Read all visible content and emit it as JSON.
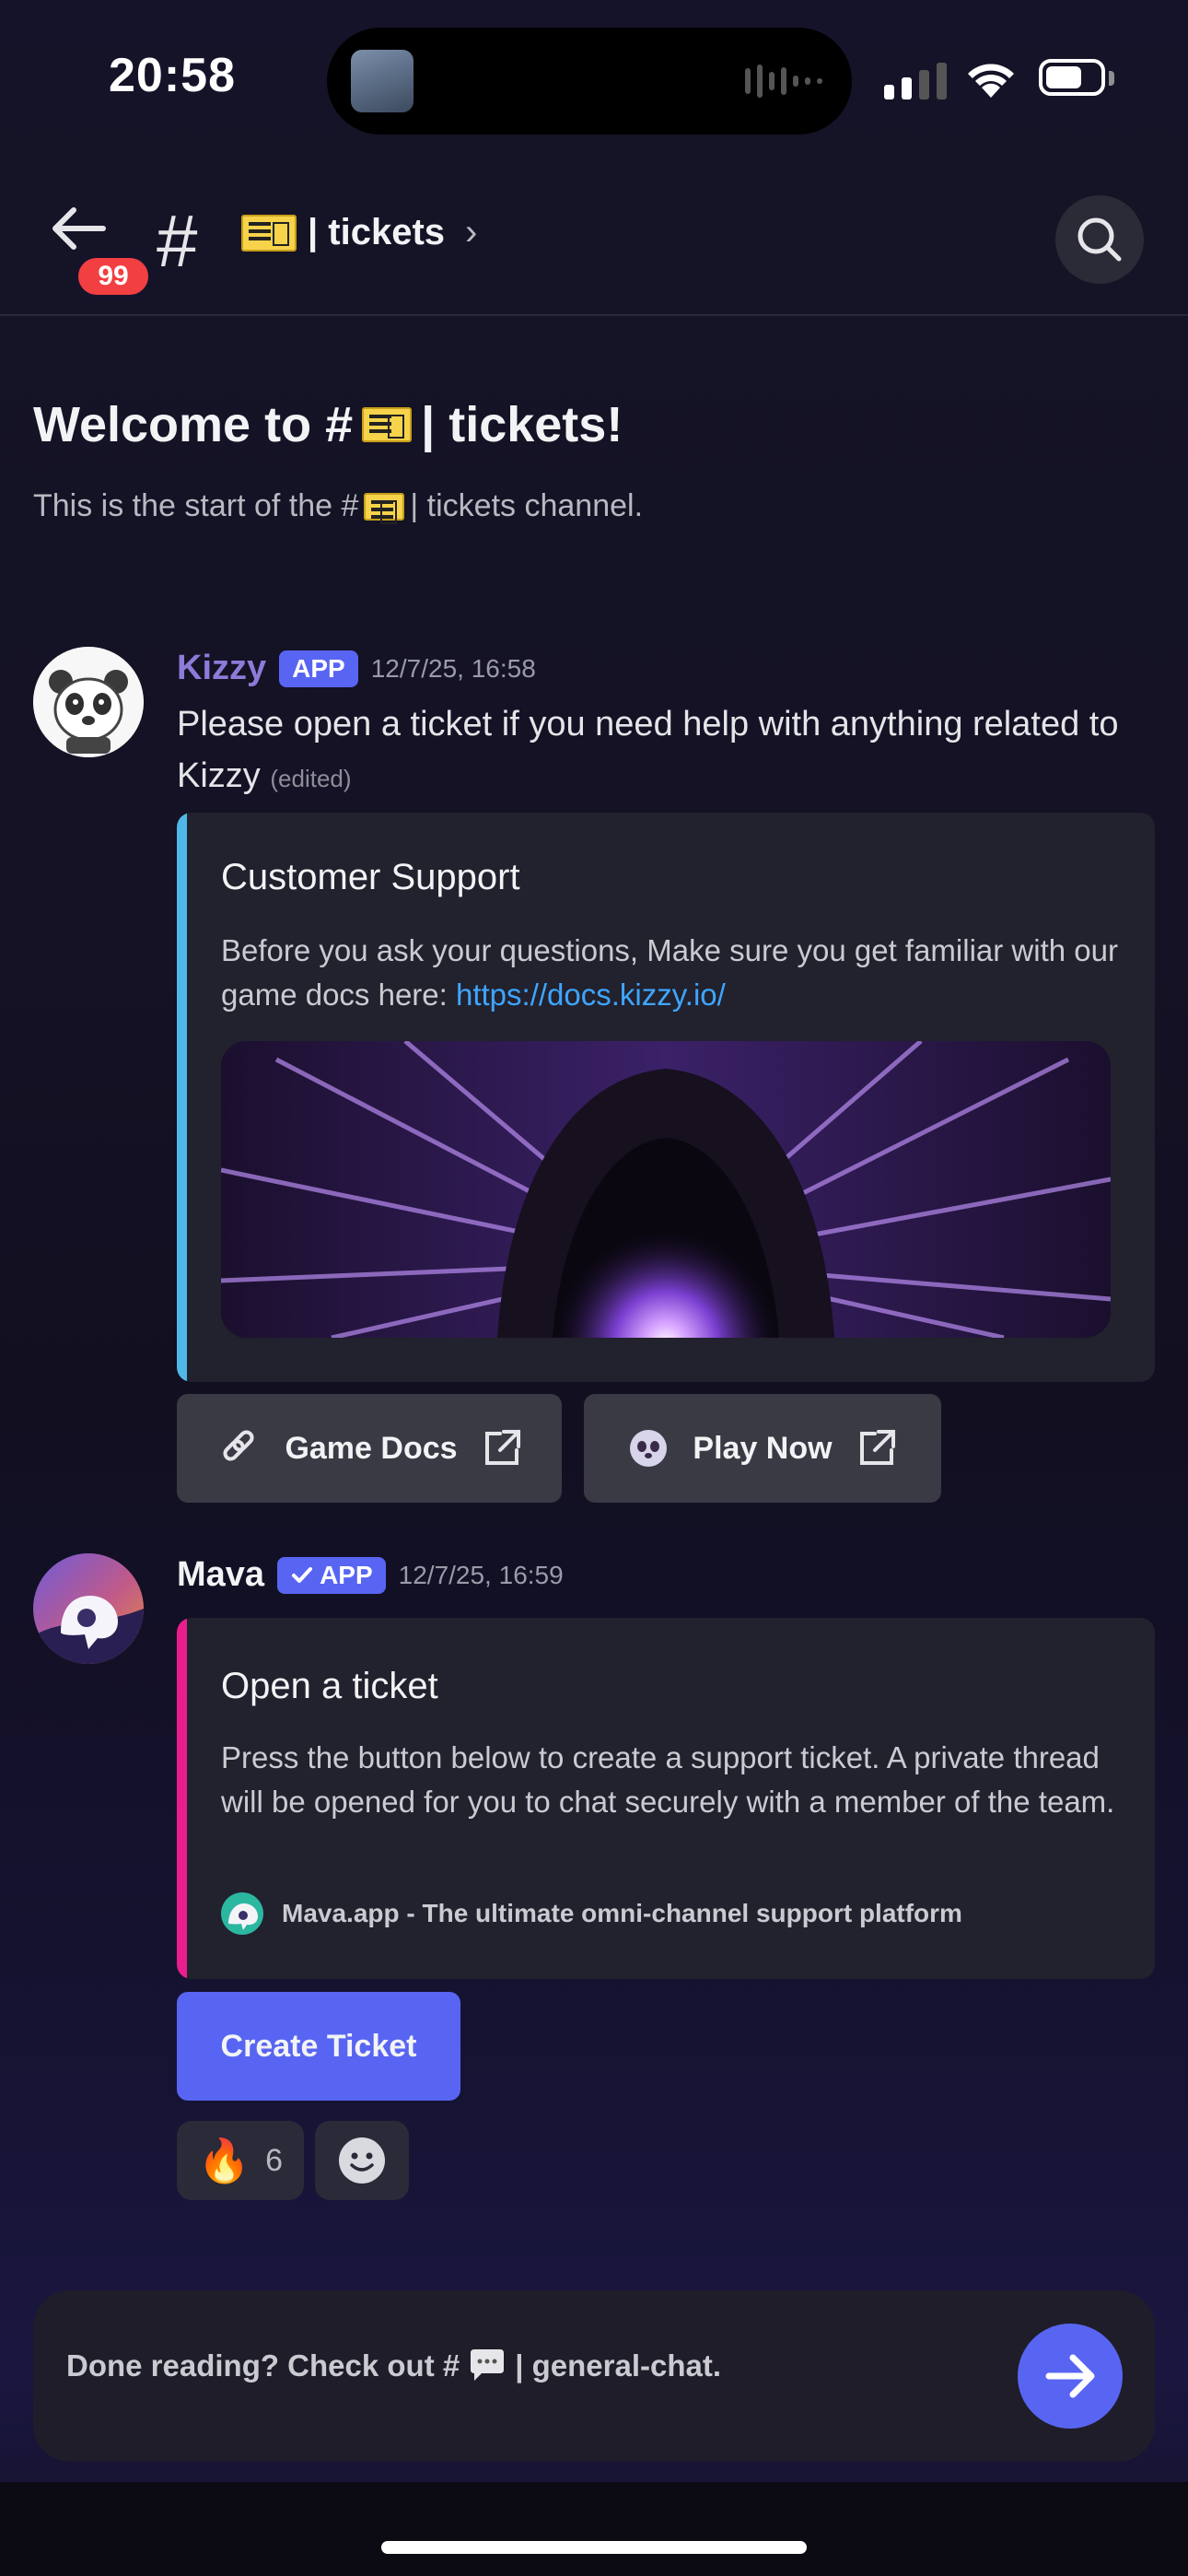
{
  "status_bar": {
    "time": "20:58"
  },
  "header": {
    "unread_badge": "99",
    "channel_prefix": "#",
    "channel_name": "| tickets",
    "chevron": "›"
  },
  "welcome": {
    "title_prefix": "Welcome to #",
    "title_suffix": "| tickets!",
    "subtitle_prefix": "This is the start of the #",
    "subtitle_suffix": "| tickets channel."
  },
  "messages": [
    {
      "author": "Kizzy",
      "tag": "APP",
      "timestamp": "12/7/25, 16:58",
      "text": "Please open a ticket if you need help with anything related to Kizzy",
      "edited": "(edited)",
      "embed": {
        "title": "Customer Support",
        "description": "Before you ask your questions, Make sure you get familiar with our game docs here: ",
        "link": "https://docs.kizzy.io/",
        "bar_color": "#4fb8e8"
      },
      "buttons": [
        {
          "label": "Game Docs",
          "icon": "link-icon"
        },
        {
          "label": "Play Now",
          "icon": "kizzy-emoji-icon"
        }
      ]
    },
    {
      "author": "Mava",
      "tag": "APP",
      "timestamp": "12/7/25, 16:59",
      "embed": {
        "title": "Open a ticket",
        "description": "Press the button below to create a support ticket. A private thread will be opened for you to chat securely with a member of the team.",
        "footer": "Mava.app - The ultimate omni-channel support platform",
        "bar_color": "#e91e8c"
      },
      "button": {
        "label": "Create Ticket"
      },
      "reactions": [
        {
          "emoji": "🔥",
          "count": "6"
        }
      ]
    }
  ],
  "footer": {
    "prefix": "Done reading? Check out #",
    "channel": "| general-chat."
  },
  "colors": {
    "accent": "#5865f2",
    "kizzy_name": "#8e7ad8",
    "badge": "#f23f42"
  }
}
